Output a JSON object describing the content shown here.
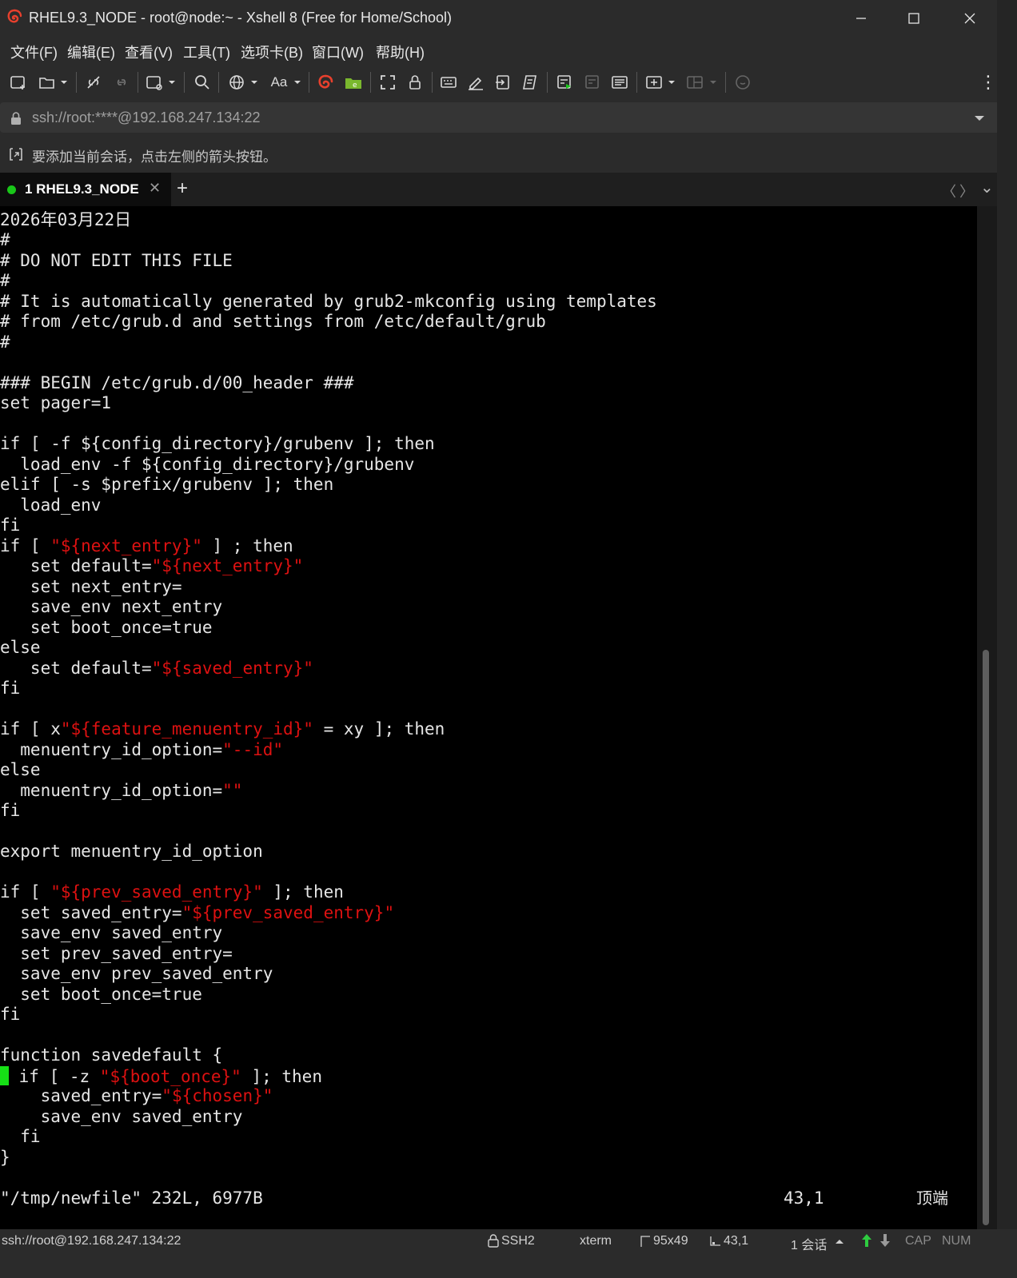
{
  "window": {
    "title": "RHEL9.3_NODE - root@node:~ - Xshell 8 (Free for Home/School)",
    "minimize": "—",
    "maximize": "☐",
    "close": "✕"
  },
  "menu": {
    "items": [
      "文件(F)",
      "编辑(E)",
      "查看(V)",
      "工具(T)",
      "选项卡(B)",
      "窗口(W)",
      "帮助(H)"
    ]
  },
  "toolbar": {
    "font_label": "Aa",
    "more": "⋮"
  },
  "address": {
    "value": "ssh://root:****@192.168.247.134:22"
  },
  "hint": {
    "text": "要添加当前会话，点击左侧的箭头按钮。"
  },
  "tabs": [
    {
      "label": "1 RHEL9.3_NODE",
      "status_color": "#19c619"
    }
  ],
  "tabbar": {
    "add": "+",
    "prev": "〈",
    "next": "〉",
    "list": "⌄"
  },
  "terminal": {
    "date_line": "2026年03月22日",
    "status_file": "\"/tmp/newfile\" 232L, 6977B",
    "status_pos": "43,1",
    "status_scroll": "顶端"
  },
  "statusbar": {
    "connection": "ssh://root@192.168.247.134:22",
    "protocol": "SSH2",
    "terminal_type": "xterm",
    "size": "95x49",
    "cursor_pos": "43,1",
    "sessions": "1 会话",
    "caps": "CAP",
    "num": "NUM"
  },
  "colors": {
    "comment": "#3f9bff",
    "string": "#dd1111",
    "cursor": "#16e016"
  }
}
